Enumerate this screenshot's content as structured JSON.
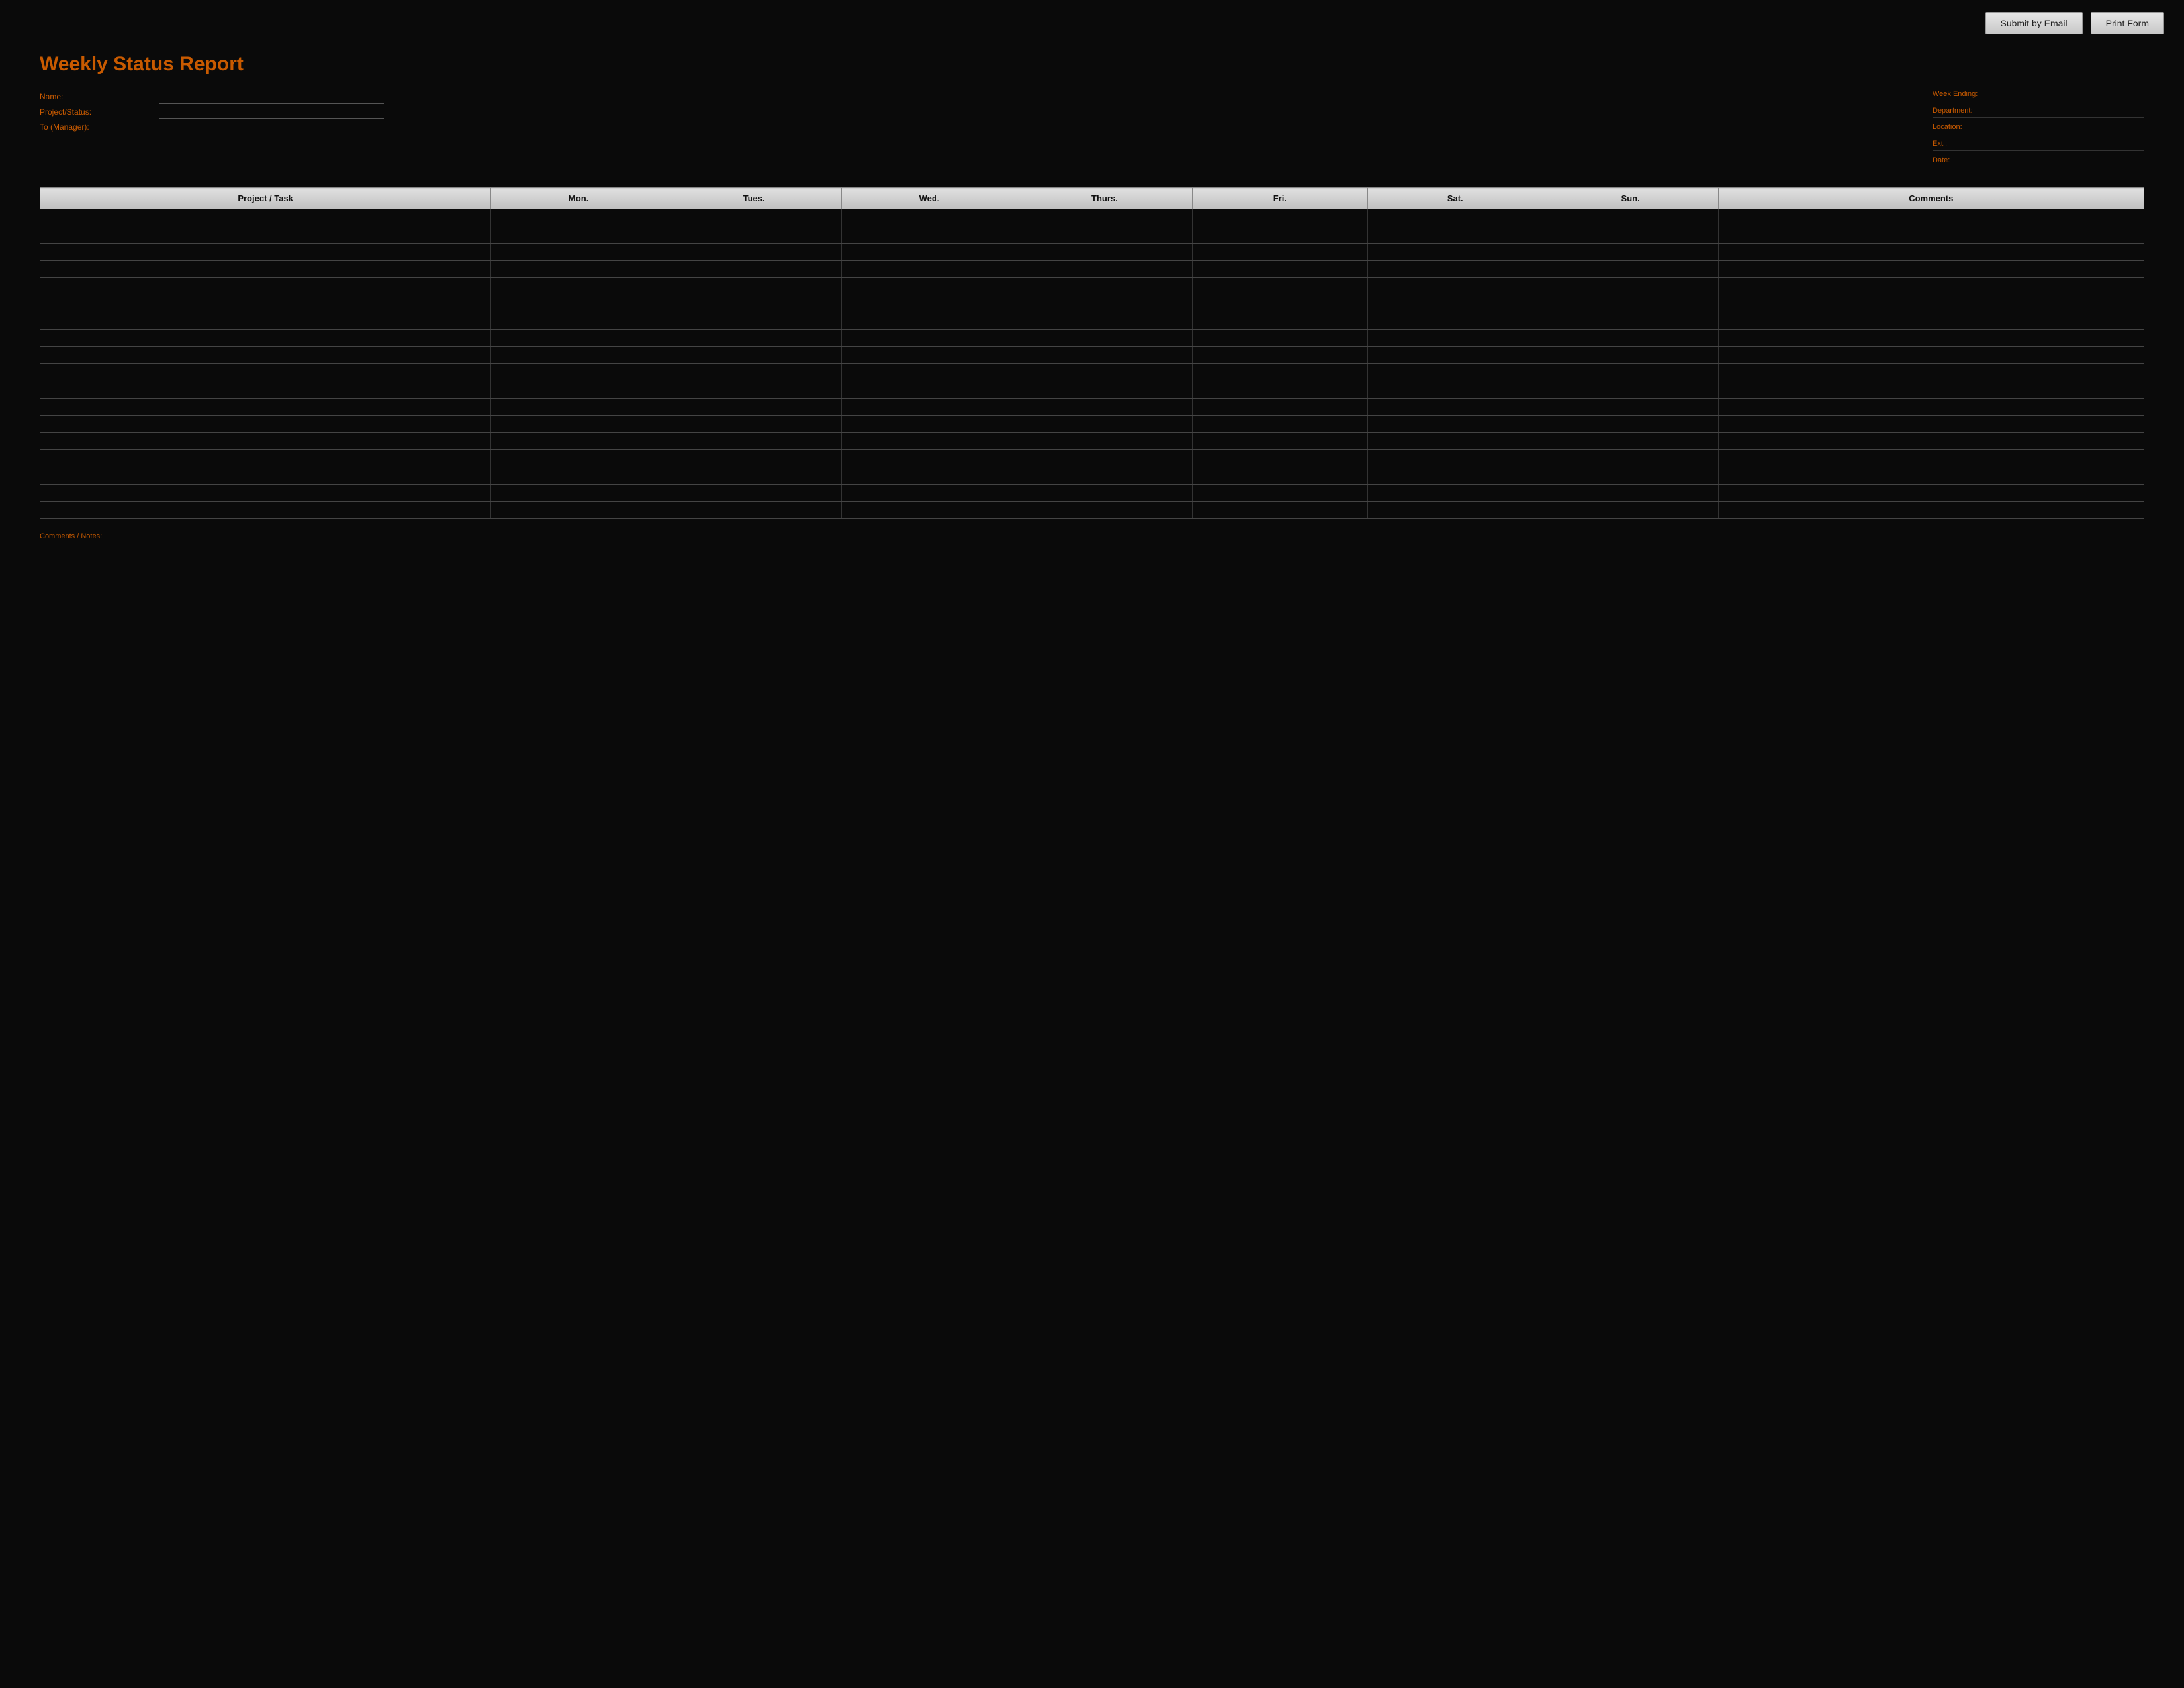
{
  "toolbar": {
    "submit_email_label": "Submit by Email",
    "print_form_label": "Print Form"
  },
  "header": {
    "title": "Weekly Status Report"
  },
  "form": {
    "name_label": "Name:",
    "name_value": "",
    "project_status_label": "Project/Status:",
    "project_status_value": "",
    "to_manager_label": "To (Manager):",
    "to_manager_value": "",
    "week_ending_label": "Week Ending:",
    "week_ending_value": "",
    "department_label": "Department:",
    "department_value": "",
    "location_label": "Location:",
    "location_value": "",
    "ext_label": "Ext.:",
    "ext_value": "",
    "date_label": "Date:",
    "date_value": ""
  },
  "table": {
    "headers": [
      "Project / Task",
      "Mon.",
      "Tues.",
      "Wed.",
      "Thurs.",
      "Fri.",
      "Sat.",
      "Sun.",
      "Comments"
    ],
    "rows": 18
  },
  "footer": {
    "note_label": "Comments / Notes:"
  }
}
